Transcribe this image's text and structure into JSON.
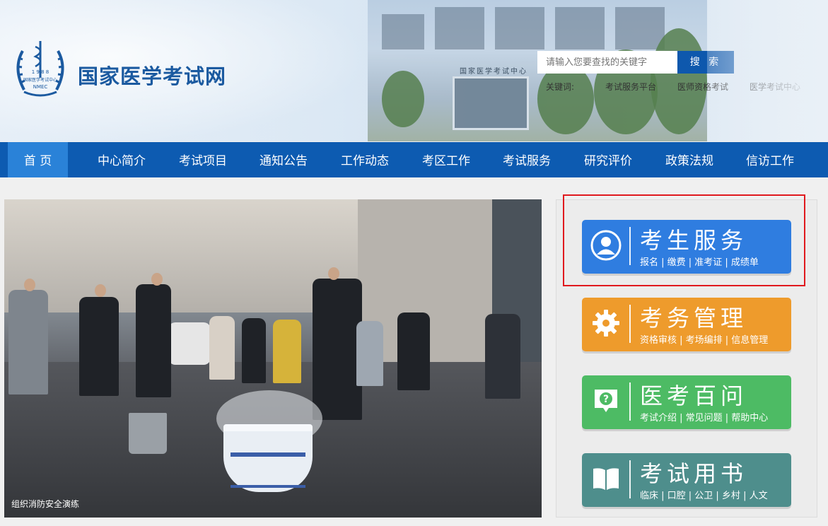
{
  "header": {
    "logo": {
      "year_text": "1 9 8 8",
      "abbr": "NMEC",
      "inner_text": "国家医学考试中心"
    },
    "site_title": "国家医学考试网",
    "building_sign": "国家医学考试中心",
    "search": {
      "placeholder": "请输入您要查找的关键字",
      "button_label": "搜 索"
    },
    "keywords": {
      "label": "关键词:",
      "items": [
        "考试服务平台",
        "医师资格考试",
        "医学考试中心"
      ]
    }
  },
  "nav": {
    "items": [
      "首 页",
      "中心简介",
      "考试项目",
      "通知公告",
      "工作动态",
      "考区工作",
      "考试服务",
      "研究评价",
      "政策法规",
      "信访工作"
    ],
    "active_index": 0
  },
  "news": {
    "caption": "组织消防安全演练"
  },
  "services": [
    {
      "title": "考生服务",
      "subtitle": "报名 | 缴费 | 准考证 | 成绩单",
      "color": "#2f7de0",
      "icon": "user-icon"
    },
    {
      "title": "考务管理",
      "subtitle": "资格审核 | 考场编排 | 信息管理",
      "color": "#ee9b2c",
      "icon": "gear-icon"
    },
    {
      "title": "医考百问",
      "subtitle": "考试介绍 | 常见问题 | 帮助中心",
      "color": "#4dbb64",
      "icon": "question-icon"
    },
    {
      "title": "考试用书",
      "subtitle": "临床 | 口腔 | 公卫 | 乡村 | 人文",
      "color": "#4e8e8c",
      "icon": "book-icon"
    }
  ]
}
